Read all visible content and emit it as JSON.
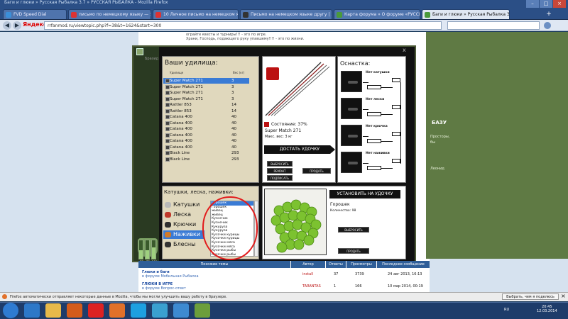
{
  "browser": {
    "window_title": "Баги и глюки » Русская Рыбалка 3.7 » РУССКАЯ РЫБАЛКА - Mozilla Firefox",
    "tabs": [
      {
        "label": "FVD Speed Dial",
        "icon_color": "#3b8fd9"
      },
      {
        "label": "письмо по немецкому языку — Янд...",
        "icon_color": "#d33"
      },
      {
        "label": "10 Личное письмо на немецком языке",
        "icon_color": "#d33"
      },
      {
        "label": "Письмо на немецком языке другу | ...",
        "icon_color": "#333"
      },
      {
        "label": "Карта форума » О форуме «РУССК...",
        "icon_color": "#4a9a3a"
      },
      {
        "label": "Баги и глюки » Русская Рыбалка 3.7 ...",
        "icon_color": "#4a9a3a"
      }
    ],
    "new_tab": "+",
    "search_engine": "Яндекс",
    "url": "rrfanmod.ru/viewtopic.php?f=38&t=1624&start=300",
    "search_placeholder": ""
  },
  "forum": {
    "lines": [
      "ограйте квесты и турниры!!! - это по игре.",
      "Храни, Господь, подающего руку упавшему!!!! - это по жизни."
    ],
    "right_panel": {
      "heading": "БАЗУ",
      "lines": [
        "Просторы,",
        "бы"
      ],
      "footer": "Леонид"
    },
    "table": {
      "headers": [
        "Похожие темы",
        "Автор",
        "Ответы",
        "Просмотры",
        "Последнее сообщение"
      ],
      "rows": [
        {
          "title": "Глюки и баги",
          "sub": "в форуме Мобильная Рыбалка",
          "author": "install",
          "replies": "37",
          "views": "3739",
          "last": "24 авг 2013, 16:13"
        },
        {
          "title": "ГЛЮКИ В ИГРЕ",
          "sub": "в форуме Вопрос-ответ",
          "author": "TARANTAS",
          "replies": "1",
          "views": "166",
          "last": "10 мар 2014, 00:19"
        }
      ]
    }
  },
  "game": {
    "close": "x",
    "left_label": "Бразид",
    "gauges": {
      "values": [
        "78",
        "78",
        "100"
      ],
      "fill_fractions": [
        0.45,
        0.45,
        0.62
      ]
    },
    "rods": {
      "title": "Ваши удилища:",
      "col_name": "Удилище",
      "col_weight": "Вес (кг)",
      "items": [
        {
          "name": "Super Match 271",
          "weight": "3",
          "selected": true
        },
        {
          "name": "Super Match 271",
          "weight": "3"
        },
        {
          "name": "Super Match 271",
          "weight": "3"
        },
        {
          "name": "Super Match 271",
          "weight": "3"
        },
        {
          "name": "Rattler 853",
          "weight": "14"
        },
        {
          "name": "Rattler 853",
          "weight": "14"
        },
        {
          "name": "Catana 400",
          "weight": "40"
        },
        {
          "name": "Catana 400",
          "weight": "40"
        },
        {
          "name": "Catana 400",
          "weight": "40"
        },
        {
          "name": "Catana 400",
          "weight": "40"
        },
        {
          "name": "Catana 400",
          "weight": "40"
        },
        {
          "name": "Catana 400",
          "weight": "40"
        },
        {
          "name": "Black Line",
          "weight": "293"
        },
        {
          "name": "Black Line",
          "weight": "293"
        }
      ]
    },
    "rod_detail": {
      "condition": "Состояние: 37%",
      "name": "Super Match 271",
      "max_weight": "Макс. вес: 3 кг",
      "get_button": "ДОСТАТЬ УДОЧКУ",
      "buttons": {
        "throw": "ВЫБРОСИТЬ",
        "repair": "РЕМОНТ",
        "sell": "ПРОДАТЬ",
        "sign": "ПОДПИСАТЬ"
      }
    },
    "tackle": {
      "title": "Оснастка:",
      "slots": [
        "Нет катушки",
        "Нет лески",
        "Нет крючка",
        "Нет наживки"
      ]
    },
    "bait": {
      "title": "Катушки, леска, наживки:",
      "categories": [
        {
          "label": "Катушки",
          "icon_color": "#b8b8b8"
        },
        {
          "label": "Леска",
          "icon_color": "#c0392b"
        },
        {
          "label": "Крючки",
          "icon_color": "#2f2f2f"
        },
        {
          "label": "Наживки",
          "icon_color": "#d07a2a",
          "selected": true
        },
        {
          "label": "Блесны",
          "icon_color": "#333"
        }
      ],
      "list": [
        "Горошек",
        "Горошек",
        "живец",
        "живец",
        "Кузнечик",
        "Кузнечик",
        "Кукуруза",
        "Кукуруза",
        "Кусочки курицы",
        "Кусочки курицы",
        "Кусочки мяса",
        "Кусочки мяса",
        "Кусочки рыбы",
        "Кусочки рыбы"
      ],
      "selected_index": 0,
      "install_button": "УСТАНОВИТЬ НА УДОЧКУ",
      "selected_name": "Горошек",
      "quantity": "Количество: 98",
      "throw_button": "ВЫБРОСИТЬ",
      "sell_button": "ПРОДАТЬ"
    }
  },
  "notification": {
    "text": "Firefox автоматически отправляет некоторые данные в Mozilla, чтобы мы могли улучшить вашу работу в браузере.",
    "choose_button": "Выбрать, чем я поделюсь",
    "close": "×"
  },
  "taskbar": {
    "lang": "RU",
    "time": "20:45",
    "date": "12.03.2014",
    "icons": [
      {
        "name": "ie",
        "color": "#2d78c8"
      },
      {
        "name": "explorer",
        "color": "#e7b94a"
      },
      {
        "name": "media",
        "color": "#d45c1b"
      },
      {
        "name": "yandex",
        "color": "#d22"
      },
      {
        "name": "firefox",
        "color": "#e1712a"
      },
      {
        "name": "skype",
        "color": "#1ea0e0"
      },
      {
        "name": "game",
        "color": "#3aa0d0"
      },
      {
        "name": "s",
        "color": "#3d8ad1"
      },
      {
        "name": "photo",
        "color": "#6c9e3c"
      }
    ]
  }
}
